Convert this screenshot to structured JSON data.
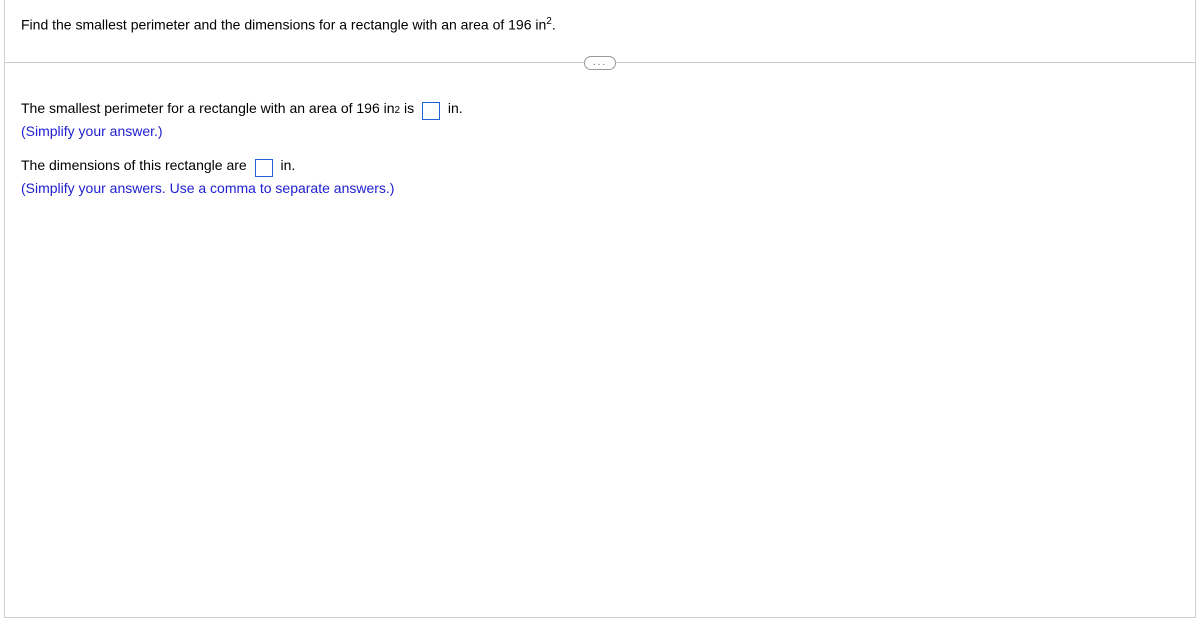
{
  "question": {
    "prefix": "Find the smallest perimeter and the dimensions for a rectangle with an area of 196 in",
    "sup": "2",
    "suffix": "."
  },
  "divider": {
    "ellipsis": "..."
  },
  "part1": {
    "prefix": "The smallest perimeter for a rectangle with an area of 196 in",
    "sup": "2",
    "mid": " is ",
    "unit": " in.",
    "hint": "(Simplify your answer.)"
  },
  "part2": {
    "prefix": "The dimensions of this rectangle are ",
    "unit": " in.",
    "hint": "(Simplify your answers. Use a comma to separate answers.)"
  }
}
